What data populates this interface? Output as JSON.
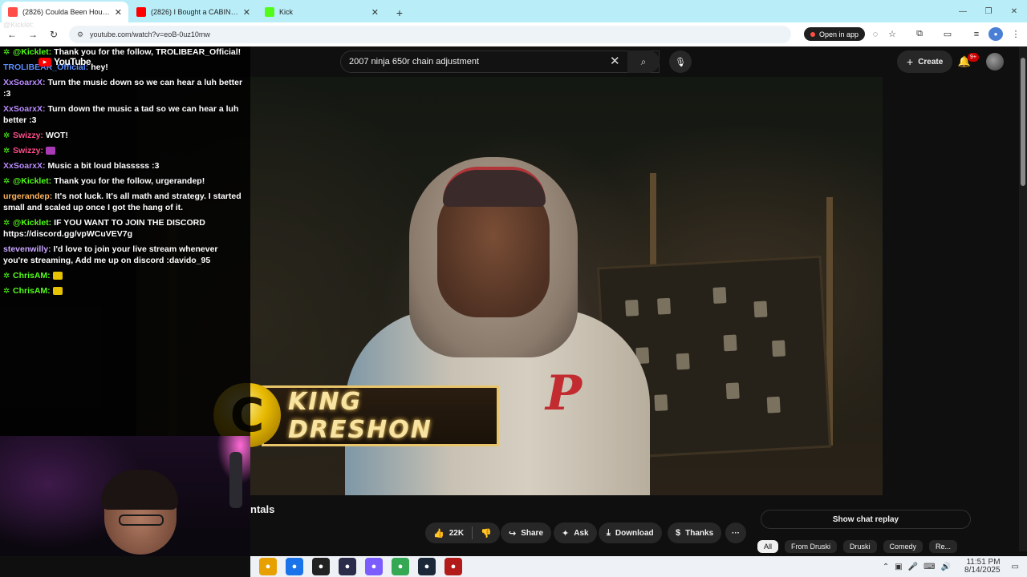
{
  "browser": {
    "tabs": [
      {
        "title": "(2826) Coulda Been House · 4?",
        "active": true,
        "favicon_color": "#ff4e45"
      },
      {
        "title": "(2826) I Bought a CABIN for the",
        "active": false,
        "favicon_color": "#ff0000"
      },
      {
        "title": "Kick",
        "active": false,
        "favicon_color": "#53fc18"
      }
    ],
    "new_tab_label": "+",
    "url": "youtube.com/watch?v=eoB-0uz10mw",
    "open_in_app_label": "Open in app"
  },
  "youtube": {
    "logo_text": "YouTube",
    "search": {
      "value": "2007 ninja 650r chain adjustment"
    },
    "create_label": "Create",
    "notification_count": "9+",
    "nameplate_text": "KING DRESHON",
    "nameplate_letter": "C",
    "video_title_fragment": "ntals",
    "actions": {
      "likes": "22K",
      "share": "Share",
      "ask": "Ask",
      "download": "Download",
      "thanks": "Thanks",
      "more": "···"
    },
    "show_chat_replay": "Show chat replay",
    "chips": [
      "All",
      "From Druski",
      "Druski",
      "Comedy",
      "Re..."
    ]
  },
  "chat": {
    "ghost_top": "@Kicklet:",
    "messages": [
      {
        "user": "@Kicklet:",
        "user_color": "#53fc18",
        "badge": true,
        "text": "Thank you for the follow, TROLIBEAR_Official!"
      },
      {
        "user": "TROLIBEAR_Official:",
        "user_color": "#5a8cff",
        "badge": false,
        "text": "hey!"
      },
      {
        "user": "XxSoarxX:",
        "user_color": "#b98cff",
        "badge": false,
        "text": "Turn the music down so we can hear a luh better :3"
      },
      {
        "user": "XxSoarxX:",
        "user_color": "#b98cff",
        "badge": false,
        "text": "Turn down the music a tad so we can hear a luh better :3"
      },
      {
        "user": "Swizzy:",
        "user_color": "#ff4e8a",
        "badge": true,
        "text": "WOT!"
      },
      {
        "user": "Swizzy:",
        "user_color": "#ff4e8a",
        "badge": true,
        "text": "",
        "emote_color": "#a83ab5"
      },
      {
        "user": "XxSoarxX:",
        "user_color": "#b98cff",
        "badge": false,
        "text": "Music a bit loud blasssss :3"
      },
      {
        "user": "@Kicklet:",
        "user_color": "#53fc18",
        "badge": true,
        "text": "Thank you for the follow, urgerandep!"
      },
      {
        "user": "urgerandep:",
        "user_color": "#ffb35c",
        "badge": false,
        "text": "It's not luck. It's all math and strategy. I started small and scaled up once I got the hang of it."
      },
      {
        "user": "@Kicklet:",
        "user_color": "#53fc18",
        "badge": true,
        "text": "IF YOU WANT TO JOIN THE DISCORD https://discord.gg/vpWCuVEV7g"
      },
      {
        "user": "stevenwilly:",
        "user_color": "#c9a6ff",
        "badge": false,
        "text": "I'd love to join your live stream whenever you're streaming, Add me up on discord :davido_95"
      },
      {
        "user": "ChrisAM:",
        "user_color": "#53fc18",
        "badge": true,
        "text": "",
        "emote_color": "#e6c200"
      },
      {
        "user": "ChrisAM:",
        "user_color": "#53fc18",
        "badge": true,
        "text": "",
        "emote_color": "#e6c200"
      }
    ]
  },
  "taskbar": {
    "apps": [
      {
        "name": "file-explorer",
        "color": "#e8a000"
      },
      {
        "name": "chrome",
        "color": "#1a73e8"
      },
      {
        "name": "app-dark",
        "color": "#222222"
      },
      {
        "name": "obs",
        "color": "#2b2b4a"
      },
      {
        "name": "copilot",
        "color": "#7b5cff"
      },
      {
        "name": "chrome-2",
        "color": "#34a853"
      },
      {
        "name": "steam",
        "color": "#1b2838"
      },
      {
        "name": "app-red",
        "color": "#b31b1b"
      }
    ],
    "time": "11:51 PM",
    "date": "8/14/2025"
  }
}
